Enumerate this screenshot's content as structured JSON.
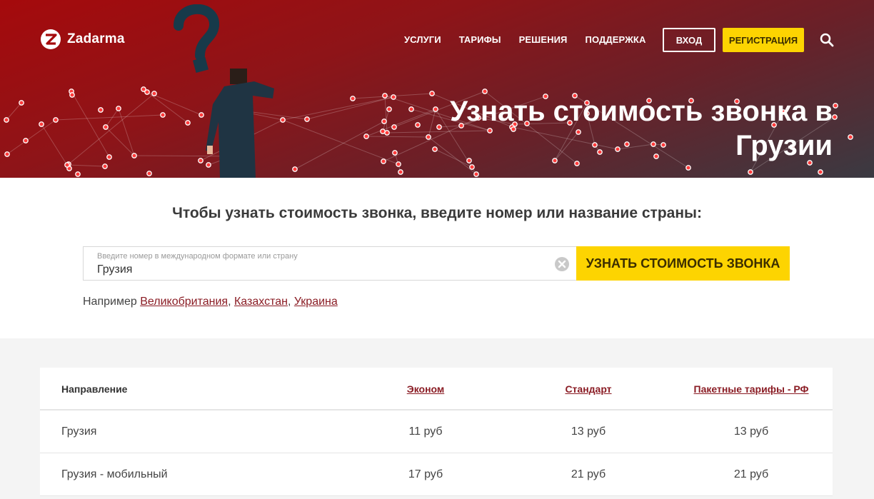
{
  "brand": {
    "name": "Zadarma"
  },
  "nav": {
    "items": [
      {
        "label": "УСЛУГИ"
      },
      {
        "label": "ТАРИФЫ"
      },
      {
        "label": "РЕШЕНИЯ"
      },
      {
        "label": "ПОДДЕРЖКА"
      }
    ],
    "login_label": "ВХОД",
    "register_label": "РЕГИСТРАЦИЯ"
  },
  "hero": {
    "title_line1": "Узнать стоимость звонка в",
    "title_line2": "Грузии"
  },
  "search": {
    "heading": "Чтобы узнать стоимость звонка, введите номер или название страны:",
    "field_label": "Введите номер в международном формате или страну",
    "field_value": "Грузия",
    "button_label": "УЗНАТЬ СТОИМОСТЬ ЗВОНКА",
    "examples_prefix": "Например",
    "examples": [
      "Великобритания",
      "Казахстан",
      "Украина"
    ]
  },
  "table": {
    "headers": [
      "Направление",
      "Эконом",
      "Стандарт",
      "Пакетные тарифы - РФ"
    ],
    "rows": [
      [
        "Грузия",
        "11 руб",
        "13 руб",
        "13 руб"
      ],
      [
        "Грузия - мобильный",
        "17 руб",
        "21 руб",
        "21 руб"
      ]
    ]
  },
  "colors": {
    "accent_yellow": "#fdd401",
    "hero_red": "#a50a0c",
    "link_dark_red": "#8a1c24"
  }
}
